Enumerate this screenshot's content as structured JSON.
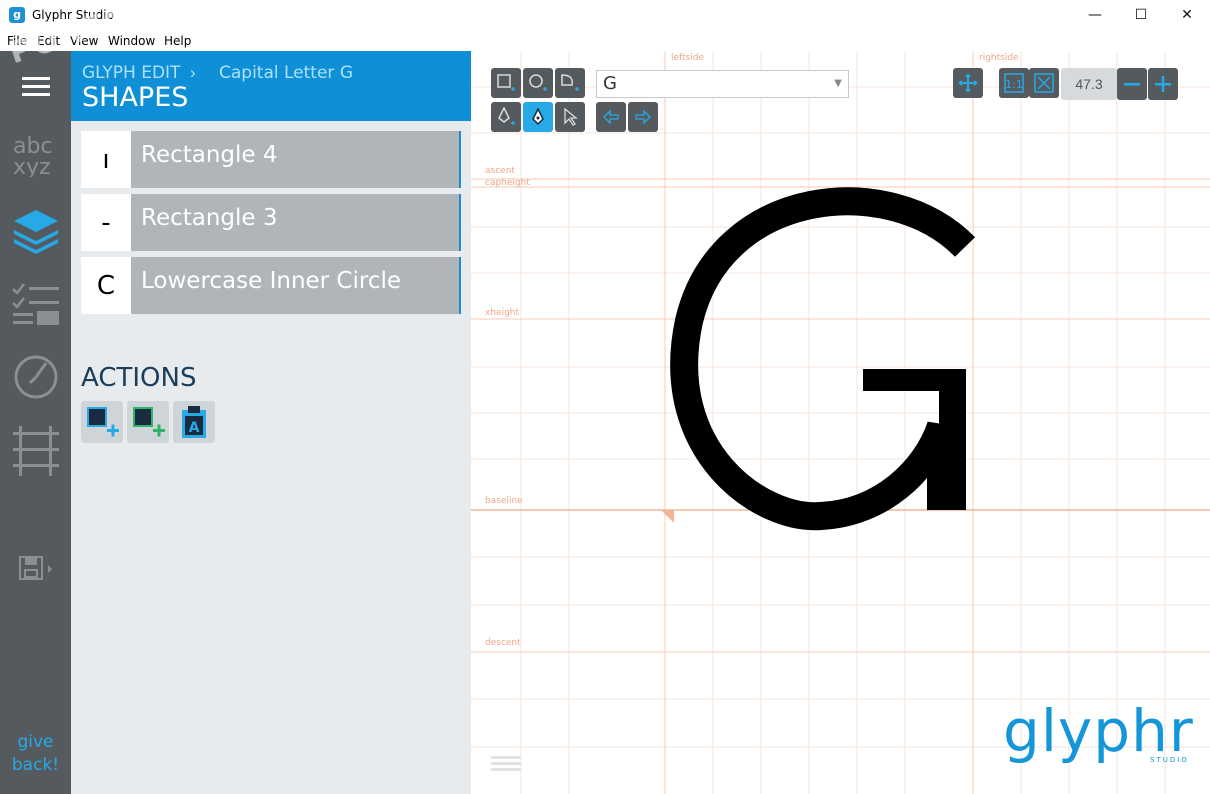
{
  "window": {
    "title": "Glyphr Studio",
    "app_icon_letter": "g",
    "minimize": "—",
    "maximize": "☐",
    "close": "✕"
  },
  "menu": [
    "File",
    "Edit",
    "View",
    "Window",
    "Help"
  ],
  "watermark": "PORTAL",
  "nav": {
    "give_back": [
      "give",
      "back!"
    ]
  },
  "panel": {
    "crumb": "GLYPH EDIT",
    "crumb_separator": "›",
    "glyph_name": "Capital Letter G",
    "title": "SHAPES",
    "shapes": [
      {
        "thumb": "ı",
        "name": "Rectangle 4"
      },
      {
        "thumb": "-",
        "name": "Rectangle 3"
      },
      {
        "thumb": "C",
        "name": "Lowercase Inner Circle"
      }
    ],
    "actions_title": "ACTIONS"
  },
  "canvas": {
    "glyph_select_value": "G",
    "zoom": "47.3",
    "guides": {
      "leftside": "leftside",
      "rightside": "rightside",
      "ascent": "ascent",
      "capheight": "capheight",
      "xheight": "xheight",
      "baseline": "baseline",
      "descent": "descent"
    },
    "glyph_char": "G",
    "logo": "glyphr",
    "logo_sub": "STUDIO"
  },
  "colors": {
    "accent": "#0f90d6",
    "nav_bg": "#555a5e",
    "guide": "#f0a787",
    "shape_row": "#b0b5b9"
  }
}
